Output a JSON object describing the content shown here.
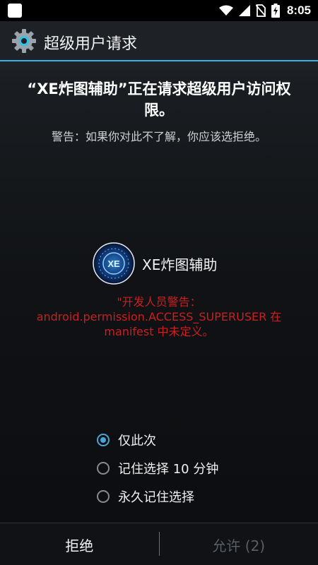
{
  "status_bar": {
    "time": "8:05",
    "icons": [
      "wifi-icon",
      "signal-icon",
      "no-sim-icon",
      "battery-charging-icon"
    ]
  },
  "title_bar": {
    "title": "超级用户请求",
    "icon": "gear-icon"
  },
  "request": {
    "headline_line1": "“XE炸图辅助”正在请求超级用户访问权",
    "headline_line2": "限。",
    "warning": "警告：如果你对此不了解，你应该选拒绝。"
  },
  "app": {
    "name": "XE炸图辅助",
    "icon_text": "XE"
  },
  "developer_warning": {
    "line1": "\"开发人员警告：",
    "line2": "android.permission.ACCESS_SUPERUSER 在",
    "line3": "manifest 中未定义。"
  },
  "options": [
    {
      "label": "仅此次",
      "checked": true
    },
    {
      "label": "记住选择 10 分钟",
      "checked": false
    },
    {
      "label": "永久记住选择",
      "checked": false
    }
  ],
  "buttons": {
    "deny": "拒绝",
    "allow": "允许 (2)"
  },
  "colors": {
    "accent": "#33b5e5",
    "warning_red": "#cc1f1f",
    "radio_checked": "#4aa3d6"
  }
}
